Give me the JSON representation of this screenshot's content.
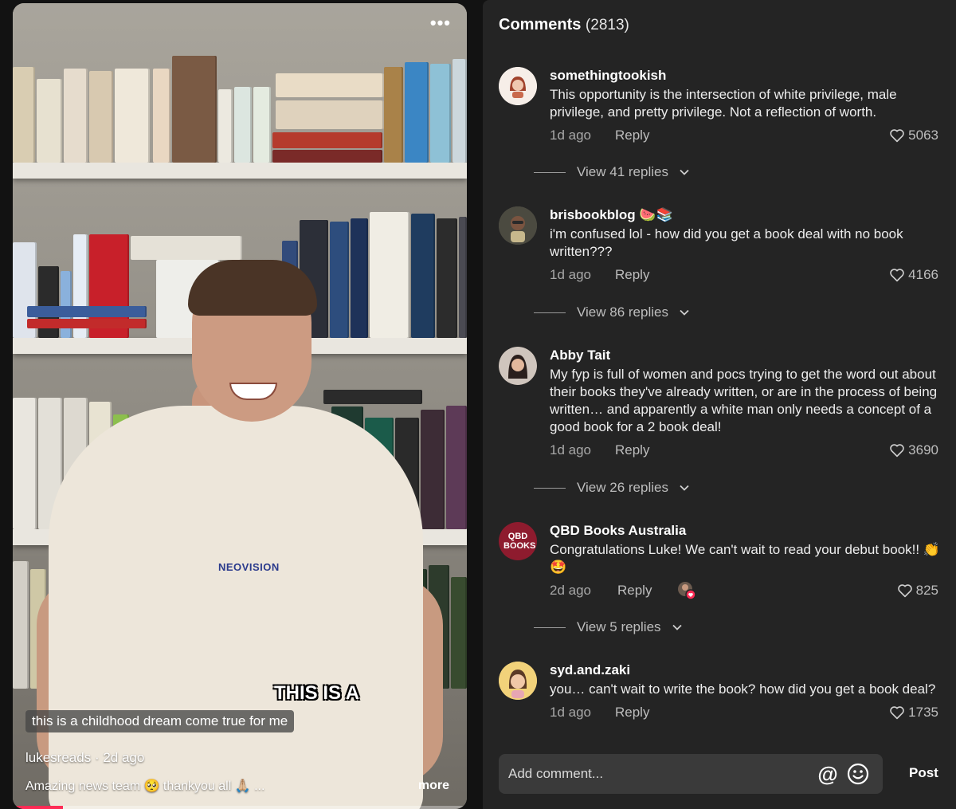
{
  "video": {
    "menu_icon": "more-dots-icon",
    "overlay_caption": "THIS IS A",
    "subtitle": "this is a childhood dream come true for me",
    "author": "lukesreads",
    "age": "2d ago",
    "description": "Amazing news team 🥺 thankyou all 🙏🏼 ...",
    "more_label": "more",
    "shirt_text": "NEOVISION",
    "progress": 0.11,
    "accent_color": "#fe2c55"
  },
  "comments_panel": {
    "title": "Comments",
    "count": "(2813)",
    "items": [
      {
        "user": "somethingtookish",
        "text": "This opportunity is the intersection of white privilege, male privilege, and pretty privilege. Not a reflection of worth.",
        "age": "1d ago",
        "reply": "Reply",
        "likes": "5063",
        "view_replies": "View 41 replies",
        "avatar_color": "#f4e9e2"
      },
      {
        "user": "brisbookblog 🍉📚",
        "text": "i'm confused lol - how did you get a book deal with no book written???",
        "age": "1d ago",
        "reply": "Reply",
        "likes": "4166",
        "view_replies": "View 86 replies",
        "avatar_color": "#5b5a4d"
      },
      {
        "user": "Abby Tait",
        "text": "My fyp is full of women and pocs trying to get the word out about their books they've already written, or are in the process of being written… and apparently a white man only needs a concept of a good book for a 2 book deal!",
        "age": "1d ago",
        "reply": "Reply",
        "likes": "3690",
        "view_replies": "View 26 replies",
        "avatar_color": "#7a6c66"
      },
      {
        "user": "QBD Books Australia",
        "text": "Congratulations Luke! We can't wait to read your debut book!! 👏🤩",
        "age": "2d ago",
        "reply": "Reply",
        "likes": "825",
        "view_replies": "View 5 replies",
        "avatar_color": "#8e1b2e",
        "avatar_text": "QBD BOOKS",
        "creator_liked": true
      },
      {
        "user": "syd.and.zaki",
        "text": "you… can't wait to write the book? how did you get a book deal?",
        "age": "1d ago",
        "reply": "Reply",
        "likes": "1735",
        "avatar_color": "#f2d27a"
      }
    ],
    "add_comment_placeholder": "Add comment...",
    "mention_icon": "at-icon",
    "emoji_icon": "emoji-icon",
    "post_label": "Post"
  }
}
